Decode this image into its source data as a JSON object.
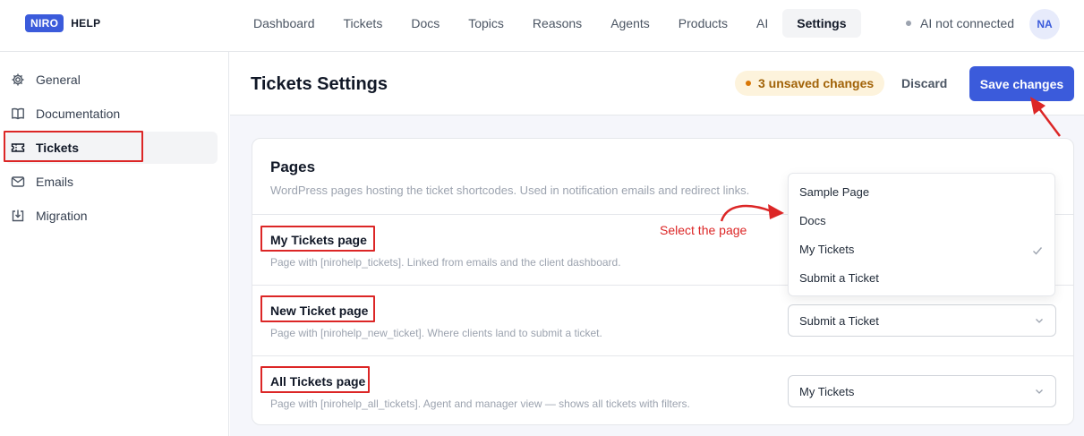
{
  "brand": {
    "badge": "NIRO",
    "name": "HELP"
  },
  "nav": [
    {
      "label": "Dashboard"
    },
    {
      "label": "Tickets"
    },
    {
      "label": "Docs"
    },
    {
      "label": "Topics"
    },
    {
      "label": "Reasons"
    },
    {
      "label": "Agents"
    },
    {
      "label": "Products"
    },
    {
      "label": "AI"
    },
    {
      "label": "Settings"
    }
  ],
  "status": {
    "label": "AI not connected"
  },
  "avatar": {
    "initials": "NA"
  },
  "sidebar": {
    "items": [
      {
        "label": "General",
        "icon": "gear-icon"
      },
      {
        "label": "Documentation",
        "icon": "book-icon"
      },
      {
        "label": "Tickets",
        "icon": "ticket-icon"
      },
      {
        "label": "Emails",
        "icon": "mail-icon"
      },
      {
        "label": "Migration",
        "icon": "import-icon"
      }
    ]
  },
  "header": {
    "title": "Tickets Settings",
    "unsaved": "3 unsaved changes",
    "discard": "Discard",
    "save": "Save changes"
  },
  "pages_card": {
    "title": "Pages",
    "description": "WordPress pages hosting the ticket shortcodes. Used in notification emails and redirect links.",
    "rows": [
      {
        "label": "My Tickets page",
        "description": "Page with [nirohelp_tickets]. Linked from emails and the client dashboard.",
        "value": "My Tickets"
      },
      {
        "label": "New Ticket page",
        "description": "Page with [nirohelp_new_ticket]. Where clients land to submit a ticket.",
        "value": "Submit a Ticket"
      },
      {
        "label": "All Tickets page",
        "description": "Page with [nirohelp_all_tickets]. Agent and manager view — shows all tickets with filters.",
        "value": "My Tickets"
      }
    ]
  },
  "dropdown": {
    "options": [
      "Sample Page",
      "Docs",
      "My Tickets",
      "Submit a Ticket"
    ],
    "selected": "My Tickets"
  },
  "annotation": {
    "text": "Select the page"
  },
  "colors": {
    "accent": "#3b5bdb",
    "annotation": "#dc2626",
    "unsaved_bg": "#fdf3dc",
    "unsaved_text": "#a16207"
  }
}
